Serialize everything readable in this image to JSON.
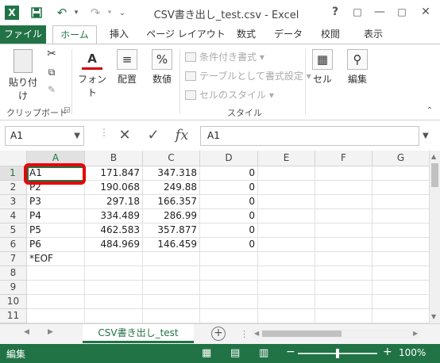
{
  "window": {
    "title": "CSV書き出し_test.csv - Excel",
    "help": "?",
    "ribbon_display": "□",
    "minimize": "—",
    "maximize": "□",
    "close": "✕"
  },
  "qat": {
    "save": "💾",
    "undo": "↶",
    "redo": "↷",
    "customize": "⌄"
  },
  "tabs": [
    {
      "label": "ファイル"
    },
    {
      "label": "ホーム"
    },
    {
      "label": "挿入"
    },
    {
      "label": "ページ レイアウト"
    },
    {
      "label": "数式"
    },
    {
      "label": "データ"
    },
    {
      "label": "校閲"
    },
    {
      "label": "表示"
    }
  ],
  "ribbon": {
    "paste": "貼り付け",
    "clipboard": "クリップボード",
    "font": "フォント",
    "alignment": "配置",
    "number": "数値",
    "number_icon": "%",
    "font_icon": "A",
    "conditional": "条件付き書式",
    "table_format": "テーブルとして書式設定",
    "cell_style": "セルのスタイル",
    "style_group": "スタイル",
    "cells": "セル",
    "editing": "編集"
  },
  "formula_bar": {
    "name_box": "A1",
    "cancel": "✕",
    "enter": "✓",
    "fx": "fx",
    "value": "A1"
  },
  "columns": [
    "A",
    "B",
    "C",
    "D",
    "E",
    "F",
    "G"
  ],
  "rows": [
    "1",
    "2",
    "3",
    "4",
    "5",
    "6",
    "7",
    "8",
    "9",
    "10",
    "11"
  ],
  "cells": {
    "r1": [
      "A1",
      "171.847",
      "347.318",
      "0"
    ],
    "r2": [
      "P2",
      "190.068",
      "249.88",
      "0"
    ],
    "r3": [
      "P3",
      "297.18",
      "166.357",
      "0"
    ],
    "r4": [
      "P4",
      "334.489",
      "286.99",
      "0"
    ],
    "r5": [
      "P5",
      "462.583",
      "357.877",
      "0"
    ],
    "r6": [
      "P6",
      "484.969",
      "146.459",
      "0"
    ],
    "r7": [
      "*EOF"
    ]
  },
  "sheet": {
    "tab": "CSV書き出し_test",
    "add": "+"
  },
  "status": {
    "mode": "編集",
    "zoom": "100%",
    "zoom_out": "−",
    "zoom_in": "+"
  },
  "colors": {
    "accent": "#217346",
    "highlight": "#e8000b"
  }
}
